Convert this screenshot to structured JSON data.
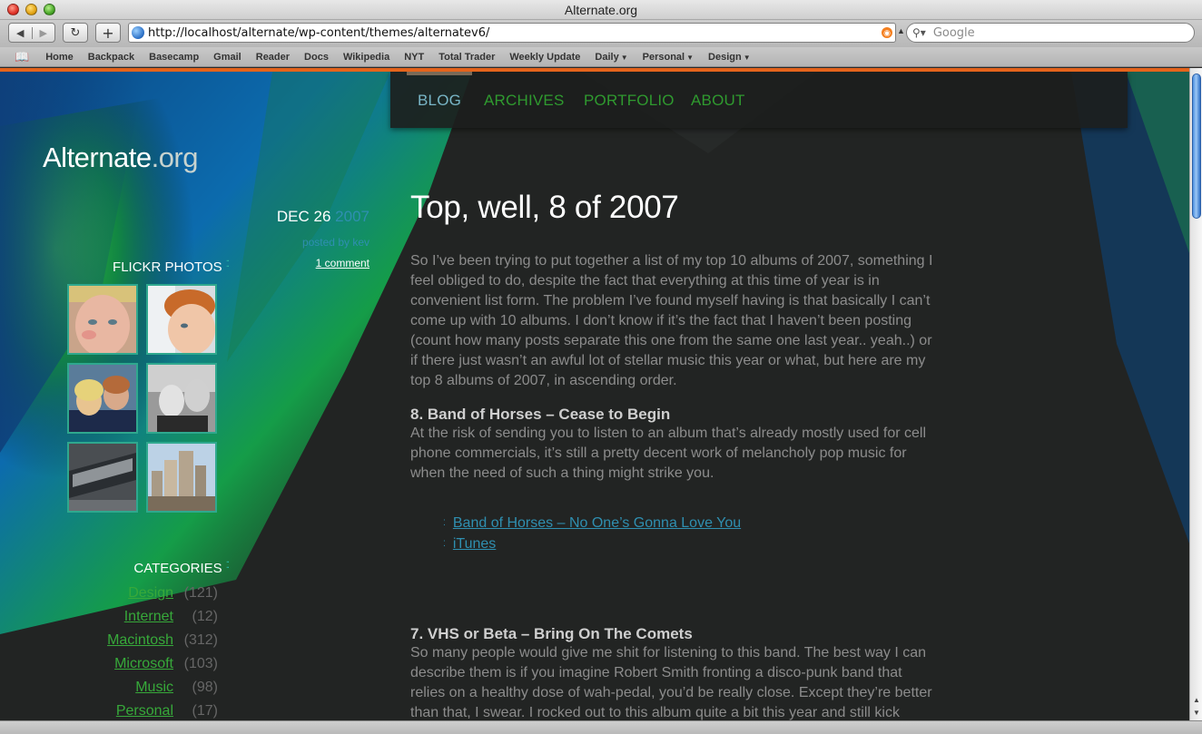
{
  "window": {
    "title": "Alternate.org"
  },
  "toolbar": {
    "back_icon": "◀",
    "forward_icon": "▶",
    "reload_icon": "↻",
    "add_icon": "+",
    "url": "http://localhost/alternate/wp-content/themes/alternatev6/",
    "search_placeholder": "Google"
  },
  "bookmarks": [
    {
      "label": "Home"
    },
    {
      "label": "Backpack"
    },
    {
      "label": "Basecamp"
    },
    {
      "label": "Gmail"
    },
    {
      "label": "Reader"
    },
    {
      "label": "Docs"
    },
    {
      "label": "Wikipedia"
    },
    {
      "label": "NYT"
    },
    {
      "label": "Total Trader"
    },
    {
      "label": "Weekly Update"
    },
    {
      "label": "Daily",
      "menu": true
    },
    {
      "label": "Personal",
      "menu": true
    },
    {
      "label": "Design",
      "menu": true
    }
  ],
  "site": {
    "logo_name": "Alternate",
    "logo_tld": ".org",
    "nav": [
      "BLOG",
      "ARCHIVES",
      "PORTFOLIO",
      "ABOUT"
    ],
    "accent_color": "#37a93a",
    "link_color": "#2f8fb0"
  },
  "sidebar": {
    "flickr_heading": "FLICKR PHOTOS",
    "categories_heading": "CATEGORIES",
    "categories": [
      {
        "name": "Design",
        "count": "(121)"
      },
      {
        "name": "Internet",
        "count": "(12)"
      },
      {
        "name": "Macintosh",
        "count": "(312)"
      },
      {
        "name": "Microsoft",
        "count": "(103)"
      },
      {
        "name": "Music",
        "count": "(98)"
      },
      {
        "name": "Personal",
        "count": "(17)"
      }
    ]
  },
  "post": {
    "date": "DEC 26",
    "year": "2007",
    "posted_by": "posted by kev",
    "comments": "1 comment",
    "title": "Top, well, 8 of 2007",
    "intro": "So I’ve been trying to put together a list of my top 10 albums of 2007, something I feel obliged to do, despite the fact that everything at this time of year is in convenient list form. The problem I’ve found myself having is that basically I can’t come up with 10 albums. I don’t know if it’s the fact that I haven’t been posting (count how many posts separate this one from the same one last year.. yeah..) or if there just wasn’t an awful lot of stellar music this year or what, but here are my top 8 albums of 2007, in ascending order.",
    "album8_title": "8. Band of Horses – Cease to Begin",
    "album8_text": "At the risk of sending you to listen to an album that’s already mostly used for cell phone commercials, it’s still a pretty decent work of melancholy pop music for when the need of such a thing might strike you.",
    "album8_links": [
      "Band of Horses – No One’s Gonna Love You",
      "iTunes"
    ],
    "album7_title": "7. VHS or Beta – Bring On The Comets",
    "album7_text": "So many people would give me shit for listening to this band. The best way I can describe them is if you imagine Robert Smith fronting a disco-punk band that relies on a healthy dose of wah-pedal, you’d be really close. Except they’re better than that, I swear. I rocked out to this album quite a bit this year and still kick myself for not seeing them at the Larimer Lounge when I could have."
  }
}
